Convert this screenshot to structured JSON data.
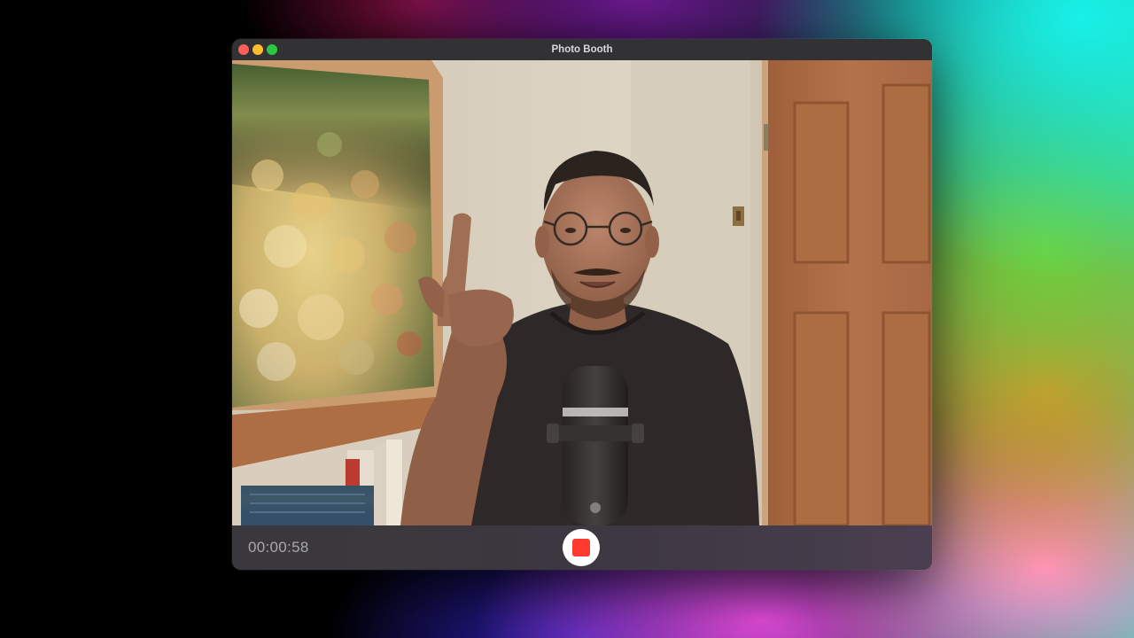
{
  "window": {
    "title": "Photo Booth"
  },
  "recording": {
    "elapsed": "00:00:58",
    "state": "recording",
    "stop_button_icon": "stop-square-icon",
    "stop_color": "#ff3b30"
  },
  "traffic_lights": {
    "close_color": "#ff5f57",
    "minimize_color": "#febc2e",
    "maximize_color": "#28c840"
  }
}
